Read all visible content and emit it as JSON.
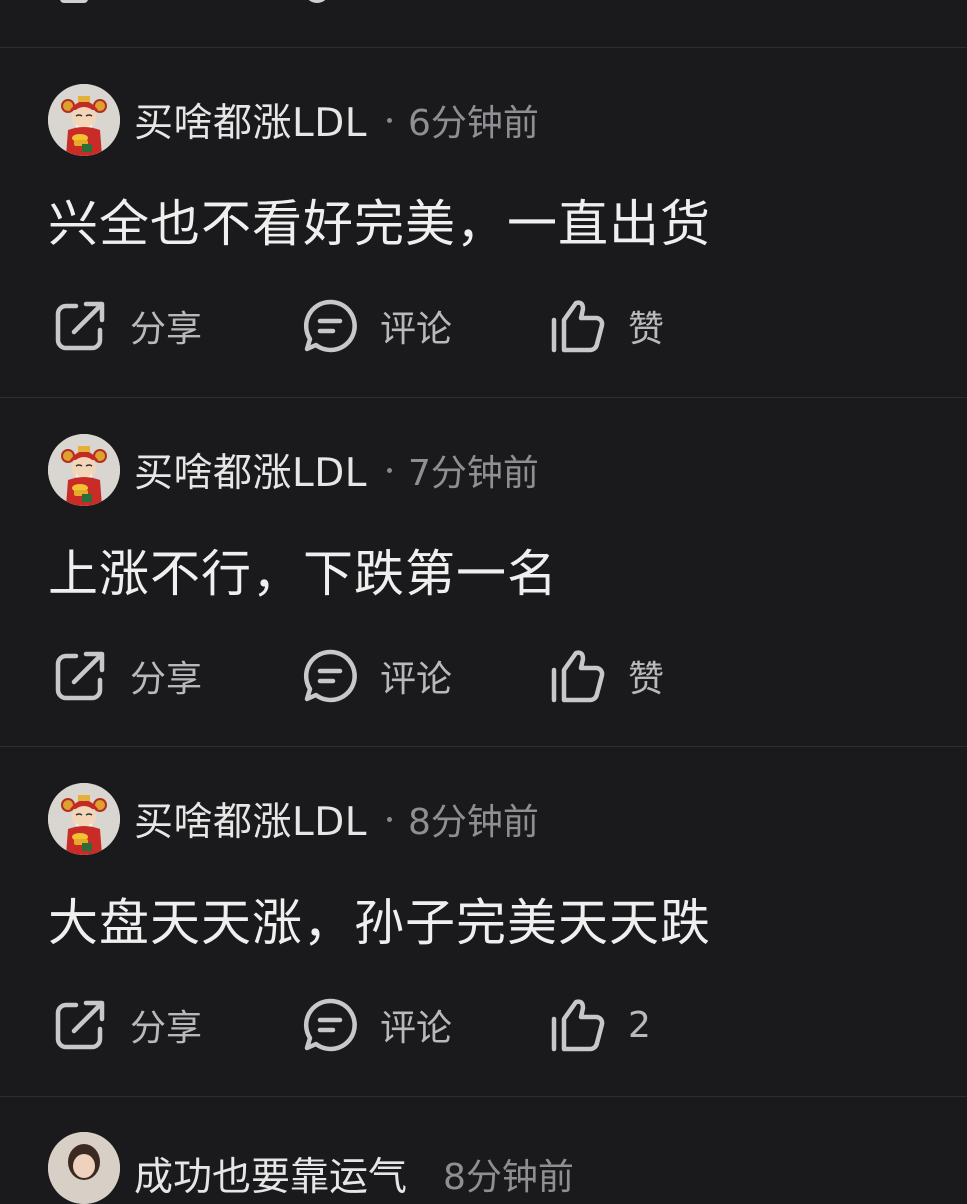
{
  "posts": [
    {
      "username": "买啥都涨LDL",
      "time": "6分钟前",
      "content": "兴全也不看好完美，一直出货",
      "actions": {
        "share": "分享",
        "comment": "评论",
        "like": "赞"
      }
    },
    {
      "username": "买啥都涨LDL",
      "time": "7分钟前",
      "content": "上涨不行，下跌第一名",
      "actions": {
        "share": "分享",
        "comment": "评论",
        "like": "赞"
      }
    },
    {
      "username": "买啥都涨LDL",
      "time": "8分钟前",
      "content": "大盘天天涨，孙子完美天天跌",
      "actions": {
        "share": "分享",
        "comment": "评论",
        "like": "2"
      }
    }
  ],
  "next_post": {
    "username": "成功也要靠运气",
    "time": "8分钟前"
  },
  "colors": {
    "background": "#1a1a1c",
    "divider": "#2e2e31",
    "text_primary": "#efefef",
    "text_secondary": "#8f8f93",
    "action_text": "#b9b9bc"
  },
  "icons": {
    "share": "share-icon",
    "comment": "comment-icon",
    "like": "thumbs-up-icon",
    "avatar": "caishen-avatar"
  }
}
